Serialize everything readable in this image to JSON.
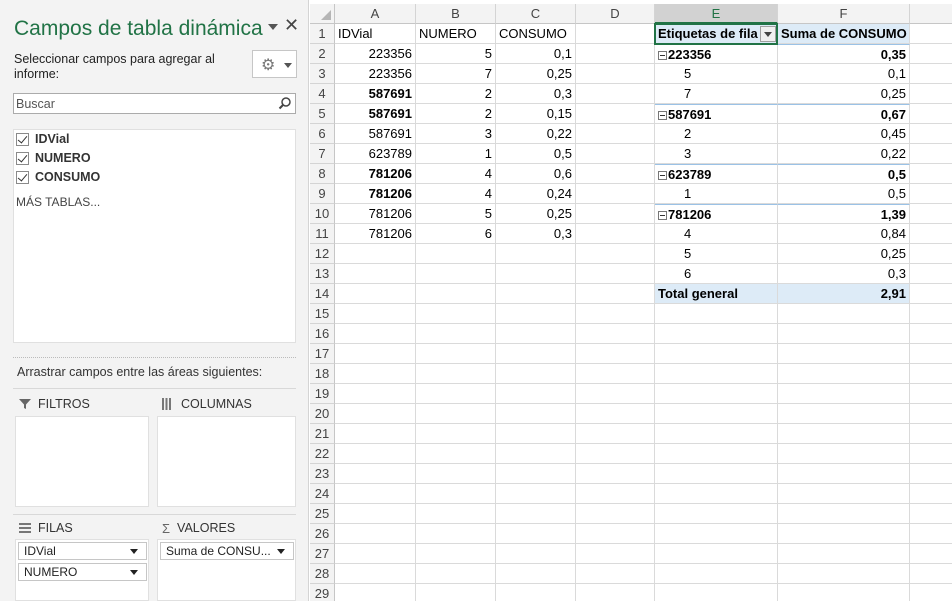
{
  "pane": {
    "title": "Campos de tabla dinámica",
    "subtitle": "Seleccionar campos para agregar al informe:",
    "search_placeholder": "Buscar",
    "fields": [
      {
        "label": "IDVial",
        "checked": true
      },
      {
        "label": "NUMERO",
        "checked": true
      },
      {
        "label": "CONSUMO",
        "checked": true
      }
    ],
    "more_tables": "MÁS TABLAS...",
    "drag_hint": "Arrastrar campos entre las áreas siguientes:",
    "areas": {
      "filters": {
        "label": "FILTROS",
        "items": []
      },
      "columns": {
        "label": "COLUMNAS",
        "items": []
      },
      "rows": {
        "label": "FILAS",
        "items": [
          "IDVial",
          "NUMERO"
        ]
      },
      "values": {
        "label": "VALORES",
        "items": [
          "Suma de CONSU..."
        ]
      }
    }
  },
  "grid": {
    "columns": [
      "A",
      "B",
      "C",
      "D",
      "E",
      "F"
    ],
    "rows": [
      "1",
      "2",
      "3",
      "4",
      "5",
      "6",
      "7",
      "8",
      "9",
      "10",
      "11",
      "12",
      "13",
      "14",
      "15",
      "16",
      "17",
      "18",
      "19",
      "20",
      "21",
      "22",
      "23",
      "24",
      "25",
      "26",
      "27",
      "28",
      "29"
    ],
    "source_headers": [
      "IDVial",
      "NUMERO",
      "CONSUMO"
    ],
    "source_rows": [
      {
        "idvial": "223356",
        "numero": "5",
        "consumo": "0,1",
        "bold": false
      },
      {
        "idvial": "223356",
        "numero": "7",
        "consumo": "0,25",
        "bold": false
      },
      {
        "idvial": "587691",
        "numero": "2",
        "consumo": "0,3",
        "bold": true
      },
      {
        "idvial": "587691",
        "numero": "2",
        "consumo": "0,15",
        "bold": true
      },
      {
        "idvial": "587691",
        "numero": "3",
        "consumo": "0,22",
        "bold": false
      },
      {
        "idvial": "623789",
        "numero": "1",
        "consumo": "0,5",
        "bold": false
      },
      {
        "idvial": "781206",
        "numero": "4",
        "consumo": "0,6",
        "bold": true
      },
      {
        "idvial": "781206",
        "numero": "4",
        "consumo": "0,24",
        "bold": true
      },
      {
        "idvial": "781206",
        "numero": "5",
        "consumo": "0,25",
        "bold": false
      },
      {
        "idvial": "781206",
        "numero": "6",
        "consumo": "0,3",
        "bold": false
      }
    ],
    "pivot": {
      "header_label": "Etiquetas de fila",
      "header_value": "Suma de CONSUMO",
      "rows": [
        {
          "label": "223356",
          "value": "0,35",
          "level": 0
        },
        {
          "label": "5",
          "value": "0,1",
          "level": 1
        },
        {
          "label": "7",
          "value": "0,25",
          "level": 1
        },
        {
          "label": "587691",
          "value": "0,67",
          "level": 0
        },
        {
          "label": "2",
          "value": "0,45",
          "level": 1
        },
        {
          "label": "3",
          "value": "0,22",
          "level": 1
        },
        {
          "label": "623789",
          "value": "0,5",
          "level": 0
        },
        {
          "label": "1",
          "value": "0,5",
          "level": 1
        },
        {
          "label": "781206",
          "value": "1,39",
          "level": 0
        },
        {
          "label": "4",
          "value": "0,84",
          "level": 1
        },
        {
          "label": "5",
          "value": "0,25",
          "level": 1
        },
        {
          "label": "6",
          "value": "0,3",
          "level": 1
        }
      ],
      "total_label": "Total general",
      "total_value": "2,91"
    }
  },
  "colors": {
    "accent": "#217346",
    "pivot_fill": "#ddebf7",
    "pivot_rule": "#9bc2e6"
  }
}
